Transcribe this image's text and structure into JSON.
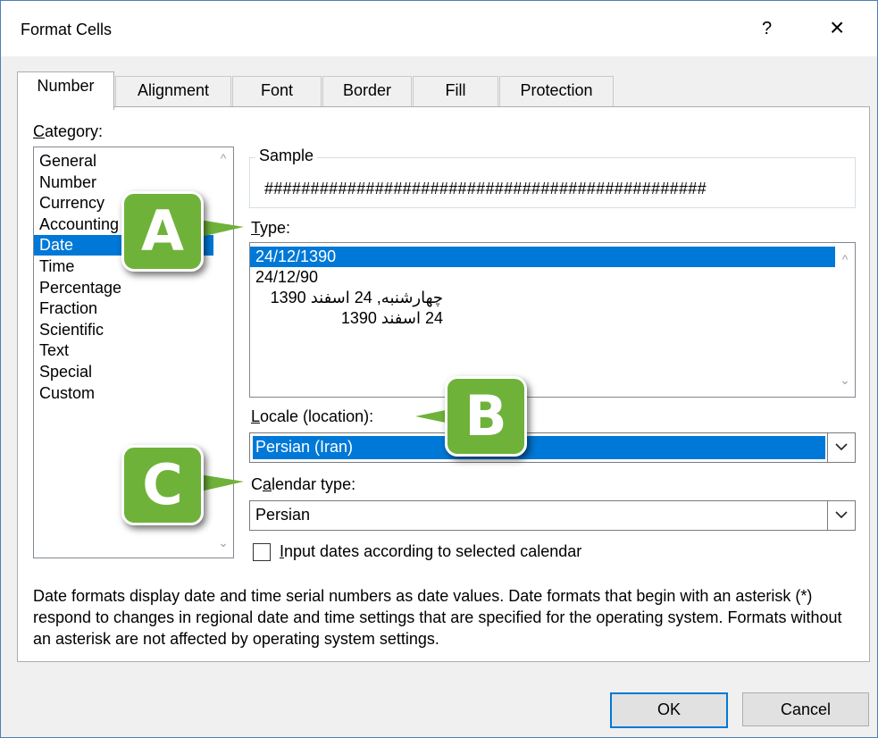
{
  "dialog": {
    "title": "Format Cells",
    "help": "?",
    "close": "×"
  },
  "tabs": [
    "Number",
    "Alignment",
    "Font",
    "Border",
    "Fill",
    "Protection"
  ],
  "category": {
    "label_u": "C",
    "label_rest": "ategory:",
    "items": [
      "General",
      "Number",
      "Currency",
      "Accounting",
      "Date",
      "Time",
      "Percentage",
      "Fraction",
      "Scientific",
      "Text",
      "Special",
      "Custom"
    ],
    "selected": "Date"
  },
  "sample": {
    "title": "Sample",
    "value": "################################################"
  },
  "type": {
    "label_u": "T",
    "label_rest": "ype:",
    "items": [
      "24/12/1390",
      "24/12/90",
      "چهارشنبه, 24 اسفند 1390",
      "24 اسفند 1390"
    ],
    "selected": "24/12/1390"
  },
  "locale": {
    "label_u": "L",
    "label_rest": "ocale (location):",
    "value": "Persian (Iran)"
  },
  "calendar": {
    "label_pre": "C",
    "label_u": "a",
    "label_rest": "lendar type:",
    "value": "Persian"
  },
  "checkbox": {
    "label_u": "I",
    "label_rest": "nput dates according to selected calendar",
    "checked": false
  },
  "description": "Date formats display date and time serial numbers as date values.  Date formats that begin with an asterisk (*) respond to changes in regional date and time settings that are specified for the operating system. Formats without an asterisk are not affected by operating system settings.",
  "buttons": {
    "ok": "OK",
    "cancel": "Cancel"
  },
  "callouts": {
    "a": "A",
    "b": "B",
    "c": "C"
  },
  "colors": {
    "selection": "#0078d7",
    "callout": "#6fb23a",
    "frame": "#4d7fb6"
  }
}
